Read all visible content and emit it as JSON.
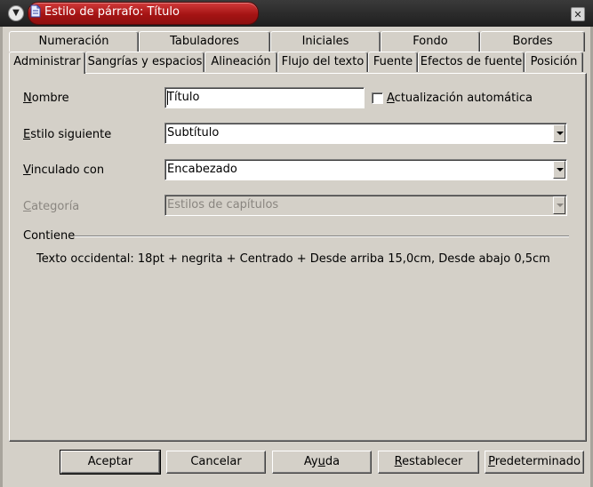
{
  "window": {
    "title": "Estilo de párrafo: Título",
    "menu_icon": "chevron-down-icon",
    "close_icon": "close-icon",
    "doc_icon": "document-icon",
    "title_color": "#b01c1c"
  },
  "tabs_back": [
    {
      "label": "Numeración"
    },
    {
      "label": "Tabuladores"
    },
    {
      "label": "Iniciales"
    },
    {
      "label": "Fondo"
    },
    {
      "label": "Bordes"
    }
  ],
  "tabs_front": [
    {
      "label": "Administrar",
      "active": true
    },
    {
      "label": "Sangrías y espacios"
    },
    {
      "label": "Alineación"
    },
    {
      "label": "Flujo del texto"
    },
    {
      "label": "Fuente"
    },
    {
      "label": "Efectos de fuente"
    },
    {
      "label": "Posición"
    }
  ],
  "form": {
    "name_label_u": "N",
    "name_label_rest": "ombre",
    "name_value": "Título",
    "autoupdate_label_u": "A",
    "autoupdate_label_rest": "ctualización automática",
    "autoupdate_checked": false,
    "next_style_label_u": "E",
    "next_style_label_rest": "stilo siguiente",
    "next_style_value": "Subtítulo",
    "linked_label_u": "V",
    "linked_label_rest": "inculado con",
    "linked_value": "Encabezado",
    "category_label_u": "C",
    "category_label_rest": "ategoría",
    "category_value": "Estilos de capítulos"
  },
  "contains": {
    "heading": "Contiene",
    "text": "Texto occidental: 18pt + negrita + Centrado + Desde arriba 15,0cm, Desde abajo 0,5cm"
  },
  "buttons": {
    "ok": "Aceptar",
    "cancel": "Cancelar",
    "help_pre": "Ay",
    "help_u": "u",
    "help_post": "da",
    "reset_u": "R",
    "reset_rest": "establecer",
    "standard_u": "P",
    "standard_rest": "redeterminado"
  }
}
